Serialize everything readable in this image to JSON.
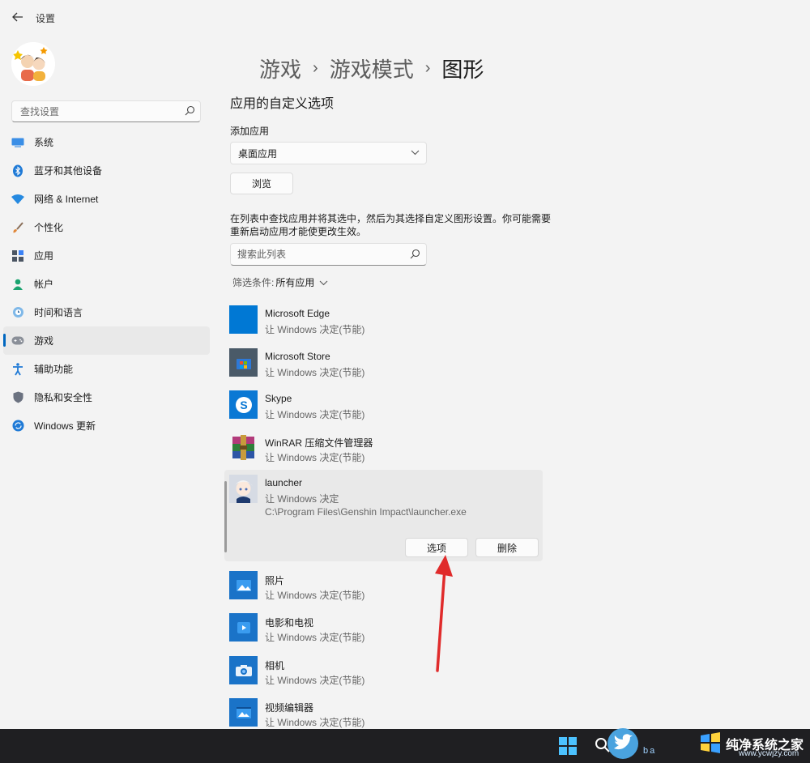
{
  "window": {
    "title": "设置"
  },
  "sidebar": {
    "search_placeholder": "查找设置",
    "items": [
      {
        "label": "系统",
        "icon": "system-icon"
      },
      {
        "label": "蓝牙和其他设备",
        "icon": "bluetooth-icon"
      },
      {
        "label": "网络 & Internet",
        "icon": "wifi-icon"
      },
      {
        "label": "个性化",
        "icon": "brush-icon"
      },
      {
        "label": "应用",
        "icon": "apps-icon"
      },
      {
        "label": "帐户",
        "icon": "account-icon"
      },
      {
        "label": "时间和语言",
        "icon": "globe-clock-icon"
      },
      {
        "label": "游戏",
        "icon": "gamepad-icon",
        "active": true
      },
      {
        "label": "辅助功能",
        "icon": "accessibility-icon"
      },
      {
        "label": "隐私和安全性",
        "icon": "shield-icon"
      },
      {
        "label": "Windows 更新",
        "icon": "update-icon"
      }
    ]
  },
  "breadcrumb": [
    "游戏",
    "游戏模式",
    "图形"
  ],
  "main": {
    "section_title": "应用的自定义选项",
    "add_app_label": "添加应用",
    "app_type_selected": "桌面应用",
    "browse_label": "浏览",
    "description": "在列表中查找应用并将其选中，然后为其选择自定义图形设置。你可能需要重新启动应用才能使更改生效。",
    "list_search_placeholder": "搜索此列表",
    "filter_label": "筛选条件:",
    "filter_value": "所有应用"
  },
  "apps": [
    {
      "name": "Microsoft Edge",
      "setting": "让 Windows 决定(节能)"
    },
    {
      "name": "Microsoft Store",
      "setting": "让 Windows 决定(节能)"
    },
    {
      "name": "Skype",
      "setting": "让 Windows 决定(节能)"
    },
    {
      "name": "WinRAR 压缩文件管理器",
      "setting": "让 Windows 决定(节能)"
    }
  ],
  "expanded_app": {
    "name": "launcher",
    "setting": "让 Windows 决定",
    "path": "C:\\Program Files\\Genshin Impact\\launcher.exe",
    "options_label": "选项",
    "delete_label": "删除"
  },
  "apps_below": [
    {
      "name": "照片",
      "setting": "让 Windows 决定(节能)"
    },
    {
      "name": "电影和电视",
      "setting": "让 Windows 决定(节能)"
    },
    {
      "name": "相机",
      "setting": "让 Windows 决定(节能)"
    },
    {
      "name": "视频编辑器",
      "setting": "让 Windows 决定(节能)"
    }
  ],
  "watermark": {
    "title": "纯净系统之家",
    "url": "www.ycwjzy.com",
    "letters": "ba"
  },
  "colors": {
    "accent": "#0067c0",
    "arrow": "#e02b2b",
    "edge_tile": "#0078d4",
    "store_tile": "#4a5a68",
    "skype_tile": "#0a78d4",
    "photos_tile": "#1a73c8"
  }
}
